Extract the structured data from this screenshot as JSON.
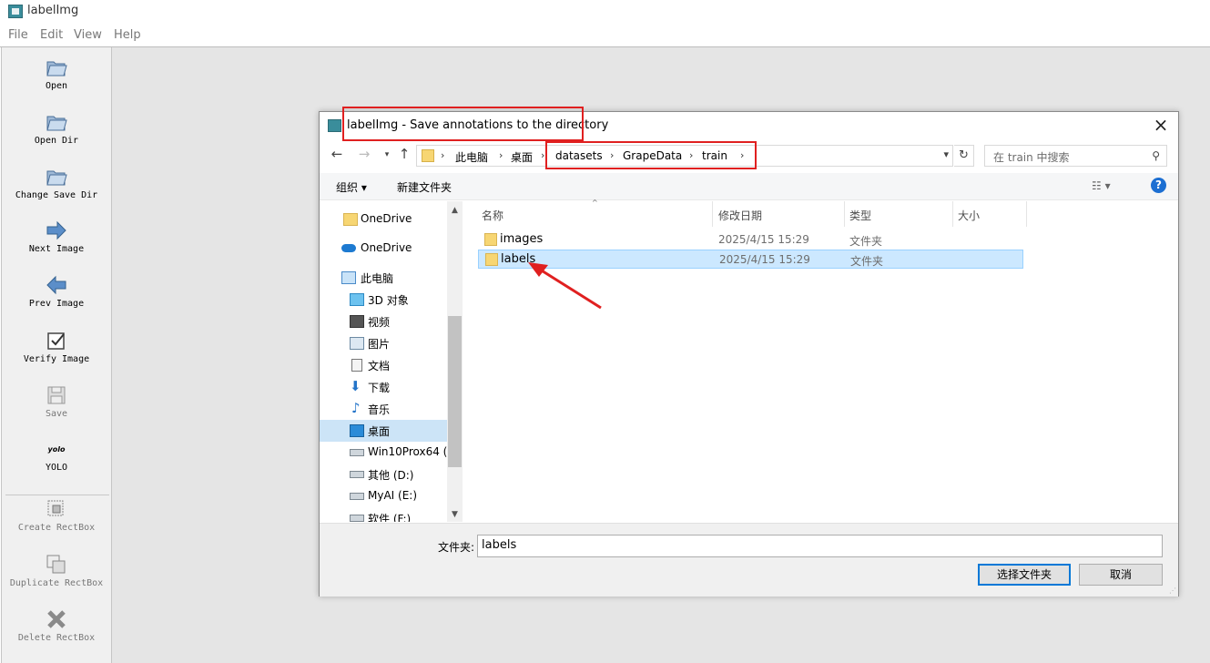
{
  "app": {
    "title": "labelImg"
  },
  "menu": [
    "File",
    "Edit",
    "View",
    "Help"
  ],
  "tools": [
    {
      "label": "Open",
      "icon": "open-folder-icon"
    },
    {
      "label": "Open Dir",
      "icon": "open-dir-icon"
    },
    {
      "label": "Change Save Dir",
      "icon": "change-save-dir-icon"
    },
    {
      "label": "Next Image",
      "icon": "arrow-right-icon"
    },
    {
      "label": "Prev Image",
      "icon": "arrow-left-icon"
    },
    {
      "label": "Verify Image",
      "icon": "checkbox-icon"
    },
    {
      "label": "Save",
      "icon": "save-icon",
      "disabled": true
    },
    {
      "label": "YOLO",
      "icon": "yolo-icon",
      "icon_text": "yolo"
    },
    {
      "label": "Create RectBox",
      "icon": "create-rectbox-icon",
      "disabled": true
    },
    {
      "label": "Duplicate RectBox",
      "icon": "duplicate-rectbox-icon",
      "disabled": true
    },
    {
      "label": "Delete RectBox",
      "icon": "delete-rectbox-icon",
      "disabled": true
    }
  ],
  "dialog": {
    "title": "labelImg - Save annotations to the directory",
    "breadcrumb": [
      "此电脑",
      "桌面",
      "datasets",
      "GrapeData",
      "train"
    ],
    "search_placeholder": "在 train 中搜索",
    "commands": {
      "organize": "组织 ▾",
      "new_folder": "新建文件夹"
    },
    "nav_items": [
      {
        "label": "OneDrive",
        "icon": "folder-icon"
      },
      {
        "label": "OneDrive",
        "icon": "cloud-icon"
      },
      {
        "label": "此电脑",
        "icon": "computer-icon"
      },
      {
        "label": "3D 对象",
        "icon": "3d-objects-icon"
      },
      {
        "label": "视频",
        "icon": "video-icon"
      },
      {
        "label": "图片",
        "icon": "pictures-icon"
      },
      {
        "label": "文档",
        "icon": "documents-icon"
      },
      {
        "label": "下载",
        "icon": "download-icon"
      },
      {
        "label": "音乐",
        "icon": "music-icon"
      },
      {
        "label": "桌面",
        "icon": "desktop-icon",
        "selected": true
      },
      {
        "label": "Win10Prox64 (",
        "icon": "drive-icon"
      },
      {
        "label": "其他 (D:)",
        "icon": "drive-icon"
      },
      {
        "label": "MyAI (E:)",
        "icon": "drive-icon"
      },
      {
        "label": "软件 (F:)",
        "icon": "drive-icon"
      }
    ],
    "columns": [
      "名称",
      "修改日期",
      "类型",
      "大小"
    ],
    "files": [
      {
        "name": "images",
        "date": "2025/4/15 15:29",
        "type": "文件夹"
      },
      {
        "name": "labels",
        "date": "2025/4/15 15:29",
        "type": "文件夹",
        "selected": true
      }
    ],
    "folder_label": "文件夹:",
    "folder_value": "labels",
    "buttons": {
      "select": "选择文件夹",
      "cancel": "取消"
    }
  },
  "colors": {
    "highlight": "#e02020",
    "selection": "#cce8ff",
    "accent": "#0078d7"
  }
}
